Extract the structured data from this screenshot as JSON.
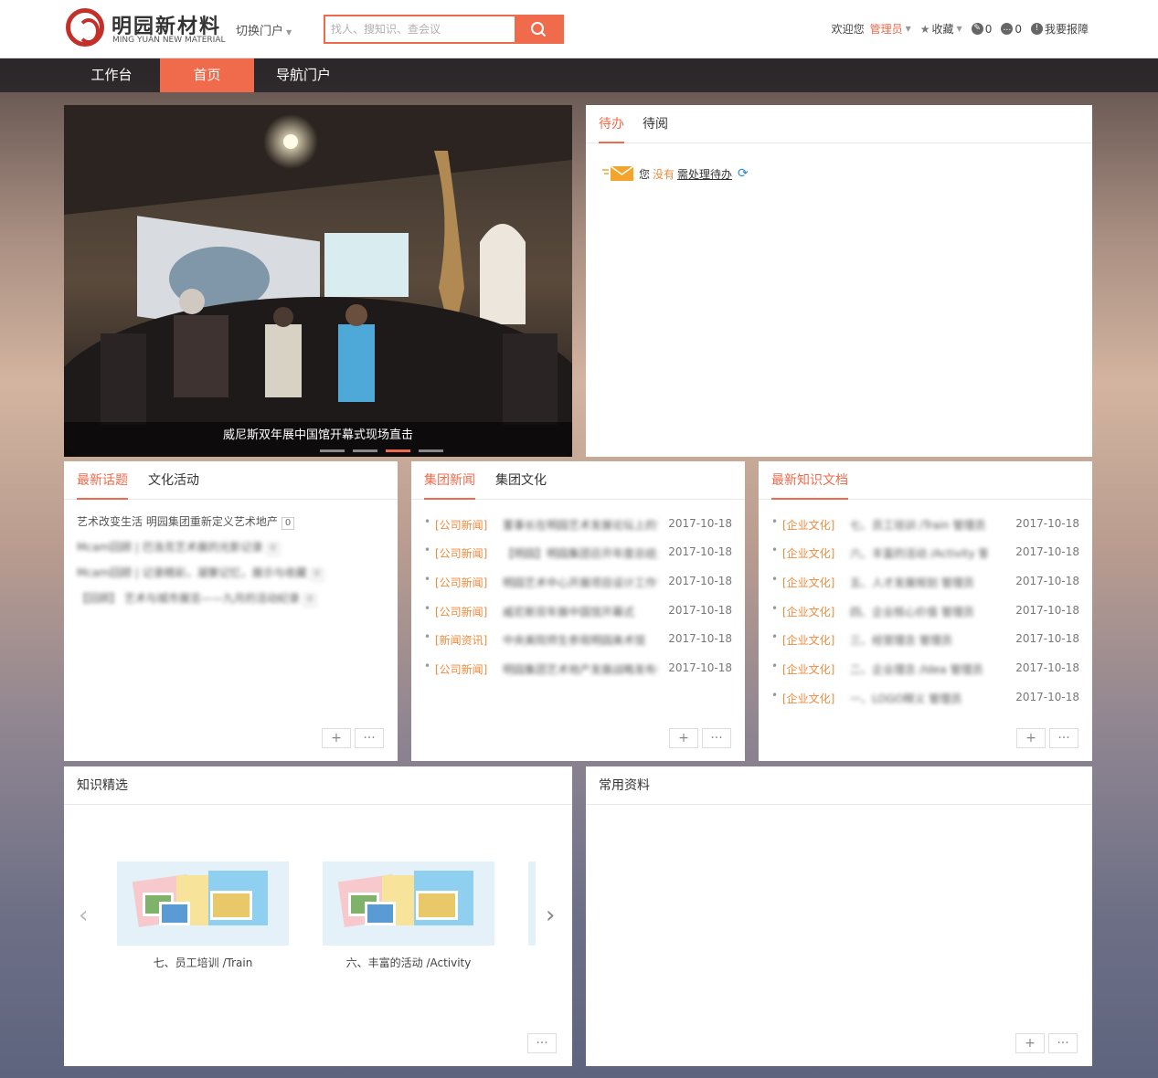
{
  "header": {
    "logo_cn": "明园新材料",
    "logo_en": "MING YUAN NEW MATERIAL",
    "switch_portal": "切换门户",
    "search_placeholder": "找人、搜知识、查会议",
    "welcome": "欢迎您",
    "username": "管理员",
    "favorites": "收藏",
    "msg_count_1": "0",
    "msg_count_2": "0",
    "report": "我要报障"
  },
  "nav": {
    "items": [
      {
        "label": "工作台"
      },
      {
        "label": "首页"
      },
      {
        "label": "导航门户"
      }
    ],
    "active": "首页"
  },
  "banner": {
    "caption": "威尼斯双年展中国馆开幕式现场直击",
    "slide_count": 4,
    "active_slide": 3
  },
  "todo": {
    "tabs": [
      "待办",
      "待阅"
    ],
    "message_prefix": "您",
    "message_highlight": "没有",
    "message_link": "需处理待办"
  },
  "topics": {
    "tabs": [
      "最新话题",
      "文化活动"
    ],
    "items": [
      {
        "text": "艺术改变生活 明园集团重新定义艺术地产",
        "count": "0"
      },
      {
        "text": "Mcam回顾 | 巴洛克艺术展的光影记录",
        "count": "0"
      },
      {
        "text": "Mcam回顾 | 记录精彩，凝聚记忆，展示与收藏",
        "count": "0"
      },
      {
        "text": "【回顾】 艺术与城市展览——九月的活动纪录",
        "count": "0"
      }
    ]
  },
  "group_news": {
    "tabs": [
      "集团新闻",
      "集团文化"
    ],
    "items": [
      {
        "cat": "[公司新闻]",
        "title": "董事长在明园艺术发展论坛上的讲话",
        "date": "2017-10-18"
      },
      {
        "cat": "[公司新闻]",
        "title": "【明园】明园集团召开年度总结大会",
        "date": "2017-10-18"
      },
      {
        "cat": "[公司新闻]",
        "title": "明园艺术中心开展项目设计工作讨论",
        "date": "2017-10-18"
      },
      {
        "cat": "[公司新闻]",
        "title": "威尼斯双年展中国馆开幕式",
        "date": "2017-10-18"
      },
      {
        "cat": "[新闻资讯]",
        "title": "中央美院师生参观明园美术馆",
        "date": "2017-10-18"
      },
      {
        "cat": "[公司新闻]",
        "title": "明园集团艺术地产发展战略发布会",
        "date": "2017-10-18"
      }
    ]
  },
  "knowledge_docs": {
    "tabs": [
      "最新知识文档"
    ],
    "items": [
      {
        "cat": "[企业文化]",
        "title": "七、员工培训 /Train 管理员",
        "date": "2017-10-18"
      },
      {
        "cat": "[企业文化]",
        "title": "六、丰富的活动 /Activity 管理员",
        "date": "2017-10-18"
      },
      {
        "cat": "[企业文化]",
        "title": "五、人才发展规划 管理员",
        "date": "2017-10-18"
      },
      {
        "cat": "[企业文化]",
        "title": "四、企业核心价值 管理员",
        "date": "2017-10-18"
      },
      {
        "cat": "[企业文化]",
        "title": "三、经营理念 管理员",
        "date": "2017-10-18"
      },
      {
        "cat": "[企业文化]",
        "title": "二、企业理念 /Idea 管理员",
        "date": "2017-10-18"
      },
      {
        "cat": "[企业文化]",
        "title": "一、LOGO释义 管理员",
        "date": "2017-10-18"
      }
    ]
  },
  "featured": {
    "title": "知识精选",
    "cards": [
      {
        "caption": "七、员工培训 /Train"
      },
      {
        "caption": "六、丰富的活动 /Activity"
      }
    ]
  },
  "resources": {
    "title": "常用资料"
  },
  "buttons": {
    "add": "+",
    "more": "···"
  },
  "colors": {
    "accent": "#f06a4c",
    "category": "#f08a3c"
  }
}
